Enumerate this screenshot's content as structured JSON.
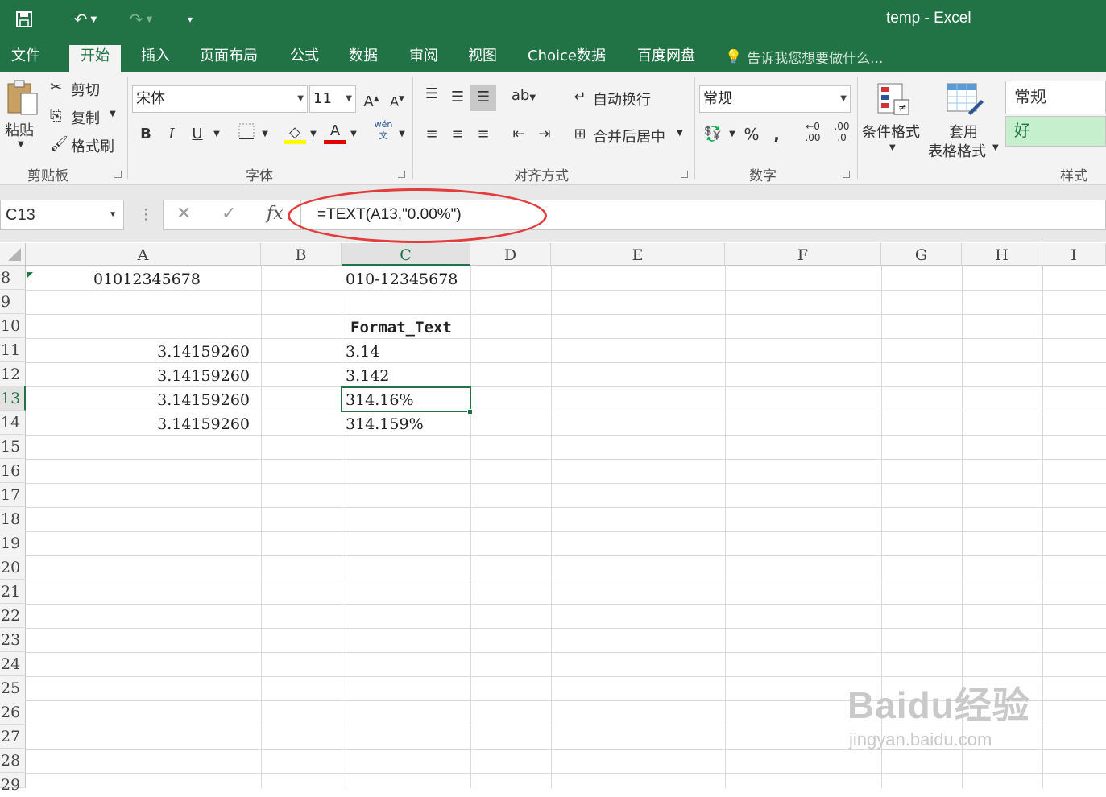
{
  "window": {
    "title": "temp - Excel"
  },
  "tabs": [
    "文件",
    "开始",
    "插入",
    "页面布局",
    "公式",
    "数据",
    "审阅",
    "视图",
    "Choice数据",
    "百度网盘"
  ],
  "tellme": "告诉我您想要做什么...",
  "ribbon": {
    "clipboard": {
      "paste": "粘贴",
      "cut": "剪切",
      "copy": "复制",
      "format_painter": "格式刷",
      "label": "剪贴板"
    },
    "font": {
      "name": "宋体",
      "size": "11",
      "bold": "B",
      "italic": "I",
      "underline": "U",
      "grow": "A",
      "shrink": "A",
      "font_color": "A",
      "phonetic": "wén",
      "label": "字体"
    },
    "alignment": {
      "wrap": "自动换行",
      "merge": "合并后居中",
      "label": "对齐方式"
    },
    "number": {
      "format": "常规",
      "percent": "%",
      "comma": ",",
      "inc_decimal": ".00",
      "dec_decimal": ".0",
      "label": "数字"
    },
    "styles": {
      "conditional": "条件格式",
      "table_l1": "套用",
      "table_l2": "表格格式",
      "style_normal": "常规",
      "style_good": "好",
      "label": "样式"
    }
  },
  "formula_bar": {
    "name_box": "C13",
    "fx": "fx",
    "formula": "=TEXT(A13,\"0.00%\")"
  },
  "columns": [
    "A",
    "B",
    "C",
    "D",
    "E",
    "F",
    "G",
    "H",
    "I"
  ],
  "rows": [
    "8",
    "9",
    "10",
    "11",
    "12",
    "13",
    "14",
    "15",
    "16",
    "17",
    "18",
    "19",
    "20",
    "21",
    "22",
    "23",
    "24",
    "25",
    "26",
    "27",
    "28",
    "29"
  ],
  "cells": {
    "A8": "01012345678",
    "C8": "010-12345678",
    "C10": "Format_Text",
    "A11": "3.14159260",
    "C11": "3.14",
    "A12": "3.14159260",
    "C12": "3.142",
    "A13": "3.14159260",
    "C13": "314.16%",
    "A14": "3.14159260",
    "C14": "314.159%"
  },
  "selected": {
    "cell": "C13",
    "column": "C",
    "row": "13"
  },
  "watermark": {
    "brand": "Baidu经验",
    "url": "jingyan.baidu.com"
  },
  "colors": {
    "excel_green": "#217346",
    "annotation_red": "#e23c3c"
  }
}
